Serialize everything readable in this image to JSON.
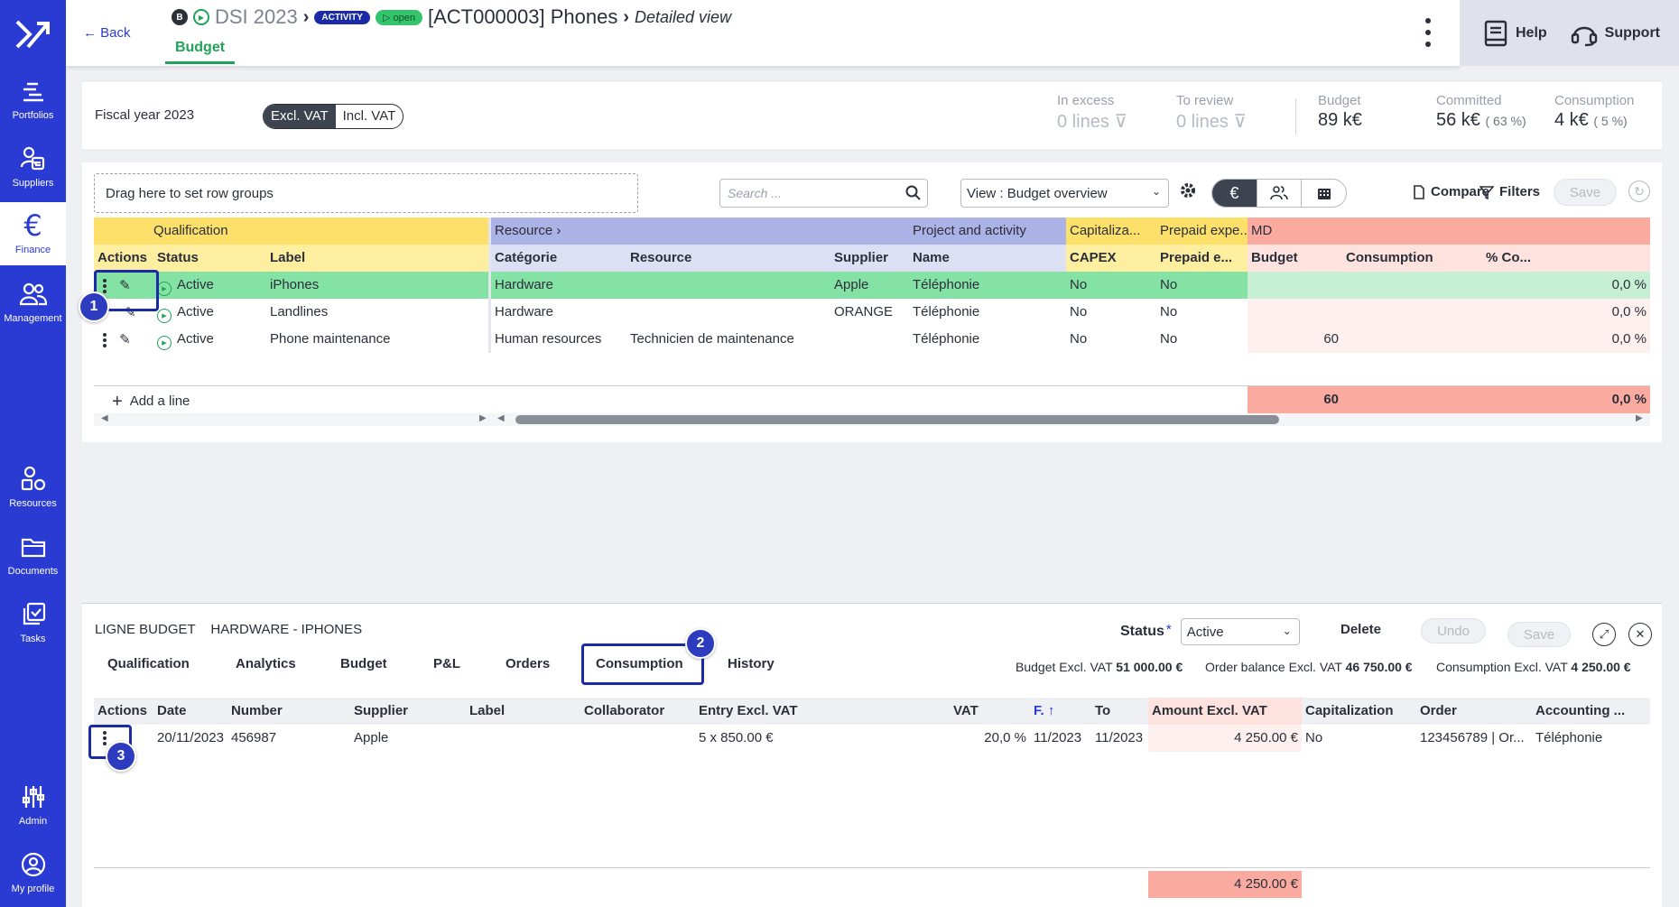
{
  "sidebar": {
    "items": [
      {
        "label": "Portfolios",
        "icon": "portfolio-icon"
      },
      {
        "label": "Suppliers",
        "icon": "suppliers-icon"
      },
      {
        "label": "Finance",
        "icon": "euro-icon"
      },
      {
        "label": "Management",
        "icon": "people-icon"
      },
      {
        "label": "Resources",
        "icon": "shapes-icon"
      },
      {
        "label": "Documents",
        "icon": "folder-icon"
      },
      {
        "label": "Tasks",
        "icon": "tasks-icon"
      },
      {
        "label": "Admin",
        "icon": "sliders-icon"
      },
      {
        "label": "My profile",
        "icon": "user-circle-icon"
      }
    ],
    "finance_glyph": "€"
  },
  "header": {
    "back": "← Back",
    "badge_b": "B",
    "portfolio": "DSI 2023",
    "activity_pill": "ACTIVITY",
    "open_pill": "▷ open",
    "title": "[ACT000003] Phones",
    "view": "Detailed view",
    "tab": "Budget",
    "help": "Help",
    "support": "Support"
  },
  "summary": {
    "fiscal_year": "Fiscal year 2023",
    "excl_vat": "Excl. VAT",
    "incl_vat": "Incl. VAT",
    "in_excess_label": "In excess",
    "in_excess_value": "0  lines",
    "to_review_label": "To review",
    "to_review_value": "0  lines",
    "budget_label": "Budget",
    "budget_value": "89 k€",
    "committed_label": "Committed",
    "committed_value": "56 k€",
    "committed_pct": "( 63 %)",
    "consumption_label": "Consumption",
    "consumption_value": "4 k€",
    "consumption_pct": "( 5 %)"
  },
  "toolbar": {
    "dropzone": "Drag here to set row groups",
    "search_placeholder": "Search ...",
    "view": "View : Budget overview",
    "euro": "€",
    "compare": "Compare",
    "filters": "Filters",
    "save": "Save"
  },
  "grid": {
    "groups": {
      "qualification": "Qualification",
      "resource": "Resource",
      "project": "Project and activity",
      "capitalization": "Capitaliza...",
      "prepaid": "Prepaid expe...",
      "md": "MD"
    },
    "columns": {
      "actions": "Actions",
      "status": "Status",
      "label": "Label",
      "categorie": "Catégorie",
      "resource": "Resource",
      "supplier": "Supplier",
      "name": "Name",
      "capex": "CAPEX",
      "prepaid": "Prepaid e...",
      "budget": "Budget",
      "consumption": "Consumption",
      "pct": "% Co..."
    },
    "rows": [
      {
        "status": "Active",
        "label": "iPhones",
        "categorie": "Hardware",
        "resource": "",
        "supplier": "Apple",
        "name": "Téléphonie",
        "capex": "No",
        "prepaid": "No",
        "budget": "",
        "consumption": "",
        "pct": "0,0 %"
      },
      {
        "status": "Active",
        "label": "Landlines",
        "categorie": "Hardware",
        "resource": "",
        "supplier": "ORANGE",
        "name": "Téléphonie",
        "capex": "No",
        "prepaid": "No",
        "budget": "",
        "consumption": "",
        "pct": "0,0 %"
      },
      {
        "status": "Active",
        "label": "Phone maintenance",
        "categorie": "Human resources",
        "resource": "Technicien de maintenance",
        "supplier": "",
        "name": "Téléphonie",
        "capex": "No",
        "prepaid": "No",
        "budget": "60",
        "consumption": "",
        "pct": "0,0 %"
      }
    ],
    "add_line": "Add a line",
    "total_budget": "60",
    "total_pct": "0,0 %"
  },
  "callouts": {
    "one": "1",
    "two": "2",
    "three": "3"
  },
  "bottom": {
    "title_prefix": "LIGNE BUDGET",
    "title_name": "HARDWARE - IPHONES",
    "status_label": "Status",
    "status_required": "*",
    "status_value": "Active",
    "delete": "Delete",
    "undo": "Undo",
    "save": "Save",
    "tabs": [
      "Qualification",
      "Analytics",
      "Budget",
      "P&L",
      "Orders",
      "Consumption",
      "History"
    ],
    "budget_total_label": "Budget Excl. VAT",
    "budget_total_value": "51 000.00 €",
    "order_balance_label": "Order balance Excl. VAT",
    "order_balance_value": "46 750.00 €",
    "consumption_total_label": "Consumption Excl. VAT",
    "consumption_total_value": "4 250.00 €",
    "columns": {
      "actions": "Actions",
      "date": "Date",
      "number": "Number",
      "supplier": "Supplier",
      "label": "Label",
      "collaborator": "Collaborator",
      "entry": "Entry Excl. VAT",
      "vat": "VAT",
      "from": "F.",
      "to": "To",
      "amount": "Amount Excl. VAT",
      "capitalization": "Capitalization",
      "order": "Order",
      "accounting": "Accounting ..."
    },
    "rows": [
      {
        "date": "20/11/2023",
        "number": "456987",
        "supplier": "Apple",
        "label": "",
        "collaborator": "",
        "entry": "5 x 850.00 €",
        "vat": "20,0 %",
        "from": "11/2023",
        "to": "11/2023",
        "amount": "4 250.00 €",
        "capitalization": "No",
        "order": "123456789 | Or...",
        "accounting": "Téléphonie"
      }
    ],
    "total_amount": "4 250.00 €"
  }
}
